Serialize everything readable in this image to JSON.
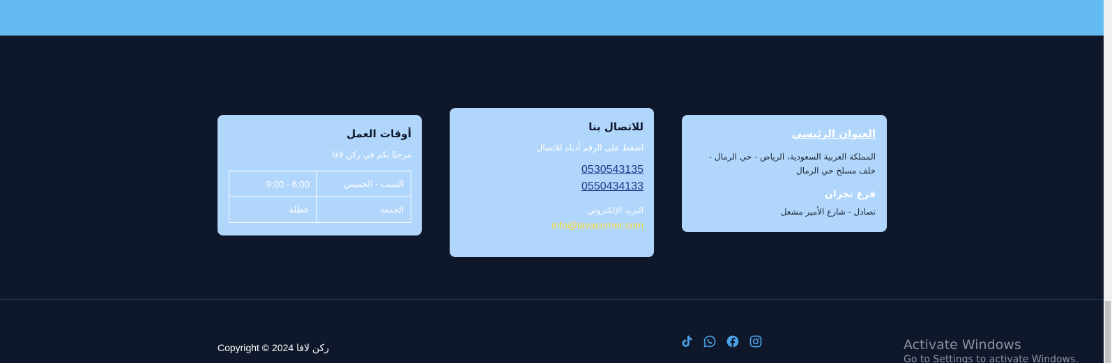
{
  "address": {
    "title": "العنوان الرئيسي",
    "text": "المملكة العربية السعودية، الرياض - حي الرمال - خلف مسلخ حي الرمال",
    "branch_title": "فرع نجران",
    "branch_text": "تصادل - شارع الأمير مشعل"
  },
  "contact": {
    "title": "للاتصال بنا",
    "subtitle": "اضغط على الرقم أدناه للاتصال",
    "phones": [
      "0530543135",
      "0550434133"
    ],
    "email_label": "البريد الإلكتروني",
    "email": "info@lavacorner.com"
  },
  "hours": {
    "title": "أوقات العمل",
    "subtitle": "مرحبًا بكم في ركن لافا",
    "rows": [
      {
        "day": "السبت - الخميس",
        "time": "6:00 - 9:00"
      },
      {
        "day": "الجمعة",
        "time": "عطلة"
      }
    ]
  },
  "footer": {
    "copyright": "Copyright © 2024 ركن لافا",
    "socials": [
      "instagram-icon",
      "facebook-icon",
      "whatsapp-icon",
      "tiktok-icon"
    ],
    "social_color": "#4aa3e8"
  },
  "system": {
    "activate_title": "Activate Windows",
    "activate_sub": "Go to Settings to activate Windows."
  },
  "colors": {
    "top_band": "#63bbf2",
    "background": "#0f172a",
    "card": "#b1d6fb",
    "email": "#fde047"
  }
}
